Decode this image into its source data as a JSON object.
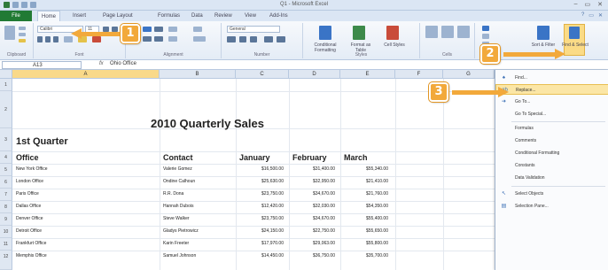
{
  "window": {
    "title": "Q1 - Microsoft Excel",
    "controls": [
      "–",
      "▭",
      "✕"
    ]
  },
  "tabs": {
    "file": "File",
    "items": [
      "Home",
      "Insert",
      "Page Layout",
      "Formulas",
      "Data",
      "Review",
      "View",
      "Add-Ins"
    ]
  },
  "ribbon": {
    "groups": [
      "Clipboard",
      "Font",
      "Alignment",
      "Number",
      "Styles",
      "Cells",
      "Editing"
    ],
    "font_name": "Calibri",
    "font_size": "11",
    "number_format": "General",
    "styles_buttons": [
      "Conditional Formatting",
      "Format as Table",
      "Cell Styles"
    ],
    "editing_buttons": [
      "Sort & Filter",
      "Find & Select"
    ]
  },
  "formula_bar": {
    "cell_ref": "A13",
    "fx": "fx",
    "content": "Ohio Office"
  },
  "columns": [
    "A",
    "B",
    "C",
    "D",
    "E",
    "F",
    "G"
  ],
  "rows": [
    "1",
    "2",
    "3",
    "4",
    "5",
    "6",
    "7",
    "8",
    "9",
    "10",
    "11",
    "12"
  ],
  "sheet": {
    "title": "2010 Quarterly Sales",
    "subtitle": "1st Quarter",
    "headers": [
      "Office",
      "Contact",
      "January",
      "February",
      "March"
    ],
    "data": [
      [
        "New York Office",
        "Valerie Gomez",
        "$16,500.00",
        "$31,400.00",
        "$55,340.00"
      ],
      [
        "London Office",
        "Ondine Calhoun",
        "$25,630.00",
        "$32,950.00",
        "$21,410.00"
      ],
      [
        "Paris Office",
        "R.R. Dona",
        "$23,750.00",
        "$34,670.00",
        "$21,760.00"
      ],
      [
        "Dallas Office",
        "Hannah Dubois",
        "$12,420.00",
        "$32,030.00",
        "$54,350.00"
      ],
      [
        "Denver Office",
        "Steve Walker",
        "$23,750.00",
        "$34,670.00",
        "$55,400.00"
      ],
      [
        "Detroit Office",
        "Gladys Pietrowicz",
        "$24,150.00",
        "$22,750.00",
        "$55,650.00"
      ],
      [
        "Frankfurt Office",
        "Karin Freeter",
        "$17,970.00",
        "$29,063.00",
        "$55,800.00"
      ],
      [
        "Memphis Office",
        "Samuel Johnson",
        "$14,450.00",
        "$36,750.00",
        "$35,700.00"
      ]
    ]
  },
  "find_menu": [
    {
      "icon": "binoculars-icon",
      "glyph": "♠",
      "label": "Find..."
    },
    {
      "icon": "replace-icon",
      "glyph": "ab",
      "label": "Replace..."
    },
    {
      "icon": "arrow-icon",
      "glyph": "➜",
      "label": "Go To..."
    },
    {
      "icon": "",
      "glyph": "",
      "label": "Go To Special..."
    },
    {
      "icon": "",
      "glyph": "",
      "label": "Formulas"
    },
    {
      "icon": "",
      "glyph": "",
      "label": "Comments"
    },
    {
      "icon": "",
      "glyph": "",
      "label": "Conditional Formatting"
    },
    {
      "icon": "",
      "glyph": "",
      "label": "Constants"
    },
    {
      "icon": "",
      "glyph": "",
      "label": "Data Validation"
    },
    {
      "icon": "select-objects-icon",
      "glyph": "↖",
      "label": "Select Objects"
    },
    {
      "icon": "selection-pane-icon",
      "glyph": "▤",
      "label": "Selection Pane..."
    }
  ],
  "callouts": [
    "1",
    "2",
    "3"
  ],
  "colors": {
    "accent": "#f2a93b",
    "file_tab": "#217a34",
    "highlight": "#fbe6a6"
  }
}
